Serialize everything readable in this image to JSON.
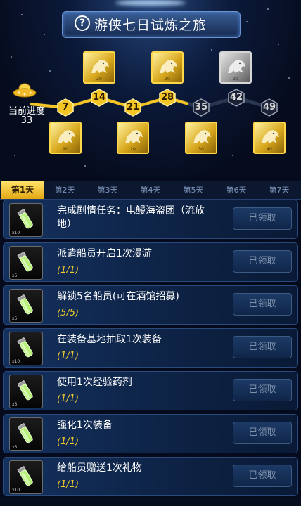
{
  "header": {
    "title": "游侠七日试炼之旅",
    "help_icon": "question-circle-icon"
  },
  "progress": {
    "current_label": "当前进度",
    "current_value": "33",
    "milestones": [
      {
        "value": "7",
        "reached": true,
        "chest_count": "20",
        "chest_state": "gold"
      },
      {
        "value": "14",
        "reached": true,
        "chest_count": "20",
        "chest_state": "gold"
      },
      {
        "value": "21",
        "reached": true,
        "chest_count": "20",
        "chest_state": "gold"
      },
      {
        "value": "28",
        "reached": true,
        "chest_count": "20",
        "chest_state": "gold"
      },
      {
        "value": "35",
        "reached": false,
        "chest_count": "30",
        "chest_state": "gold"
      },
      {
        "value": "42",
        "reached": false,
        "chest_count": "30",
        "chest_state": "grey"
      },
      {
        "value": "49",
        "reached": false,
        "chest_count": "40",
        "chest_state": "gold"
      }
    ]
  },
  "tabs": [
    "第1天",
    "第2天",
    "第3天",
    "第4天",
    "第5天",
    "第6天",
    "第7天"
  ],
  "active_tab": 0,
  "tasks": [
    {
      "title": "完成剧情任务：电鳗海盗团（流放地）",
      "progress": "",
      "reward_qty": "x10",
      "button": "已领取"
    },
    {
      "title": "派遣船员开启1次漫游",
      "progress": "(1/1)",
      "reward_qty": "x5",
      "button": "已领取"
    },
    {
      "title": "解锁5名船员(可在酒馆招募)",
      "progress": "(5/5)",
      "reward_qty": "x5",
      "button": "已领取"
    },
    {
      "title": "在装备基地抽取1次装备",
      "progress": "(1/1)",
      "reward_qty": "x10",
      "button": "已领取"
    },
    {
      "title": "使用1次经验药剂",
      "progress": "(1/1)",
      "reward_qty": "x5",
      "button": "已领取"
    },
    {
      "title": "强化1次装备",
      "progress": "(1/1)",
      "reward_qty": "x5",
      "button": "已领取"
    },
    {
      "title": "给船员赠送1次礼物",
      "progress": "(1/1)",
      "reward_qty": "x10",
      "button": "已领取"
    }
  ],
  "colors": {
    "accent_gold": "#f2cb2c",
    "panel": "#14315e",
    "claimed_text": "#7d8fa9"
  }
}
